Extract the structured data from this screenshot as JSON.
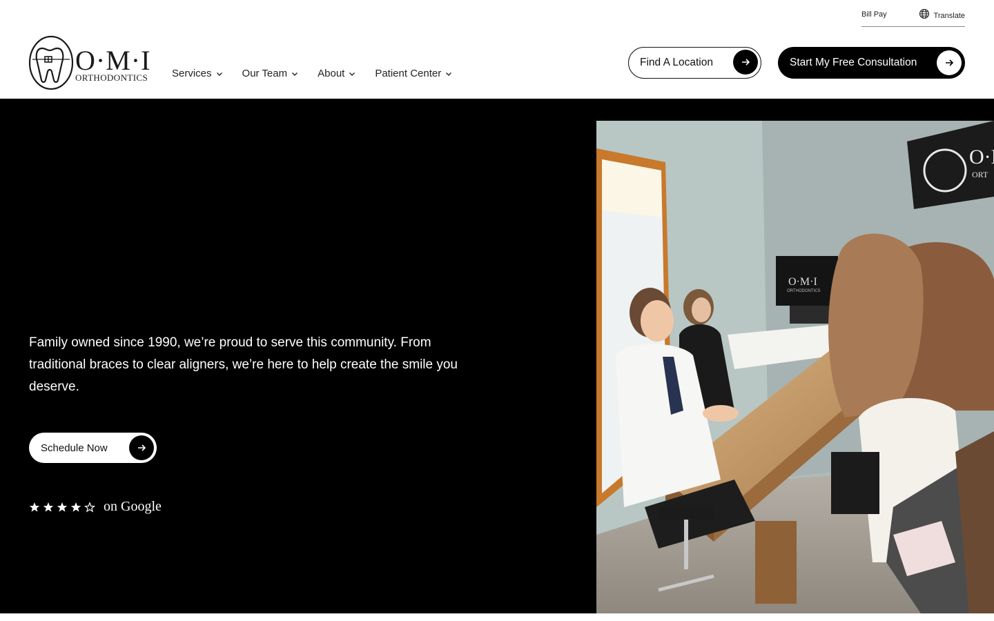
{
  "utility": {
    "bill_pay": "Bill Pay",
    "translate": "Translate"
  },
  "logo": {
    "big": "O·M·I",
    "small": "ORTHODONTICS"
  },
  "nav": {
    "items": [
      {
        "label": "Services"
      },
      {
        "label": "Our Team"
      },
      {
        "label": "About"
      },
      {
        "label": "Patient Center"
      }
    ]
  },
  "header": {
    "find_location": "Find A Location",
    "consultation": "Start My Free Consultation"
  },
  "hero": {
    "description": "Family owned since 1990, we’re proud to serve this community.  From traditional braces to clear aligners, we’re here to help create the smile you deserve.",
    "schedule_button": "Schedule Now",
    "rating": {
      "stars_filled": 4,
      "stars_total": 5,
      "source_text": "on Google"
    },
    "photo": {
      "sign_text": "O·M·I",
      "sign_sub": "ORT",
      "monitor_text": "O·M·I",
      "monitor_sub": "ORTHODONTICS"
    }
  },
  "colors": {
    "hero_bg": "#000000",
    "accent_dark": "#000000",
    "text_light": "#ffffff"
  }
}
